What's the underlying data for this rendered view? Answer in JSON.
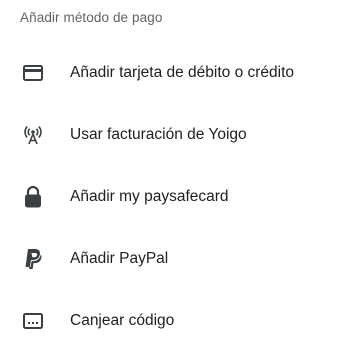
{
  "header": {
    "title": "Añadir método de pago"
  },
  "items": [
    {
      "label": "Añadir tarjeta de débito o crédito",
      "icon": "credit-card-icon"
    },
    {
      "label": "Usar facturación de Yoigo",
      "icon": "carrier-billing-icon"
    },
    {
      "label": "Añadir my paysafecard",
      "icon": "paysafecard-lock-icon"
    },
    {
      "label": "Añadir PayPal",
      "icon": "paypal-icon"
    },
    {
      "label": "Canjear código",
      "icon": "redeem-code-icon"
    }
  ],
  "colors": {
    "icon": "#3c4043",
    "text": "#202124",
    "header": "#5f6368"
  }
}
